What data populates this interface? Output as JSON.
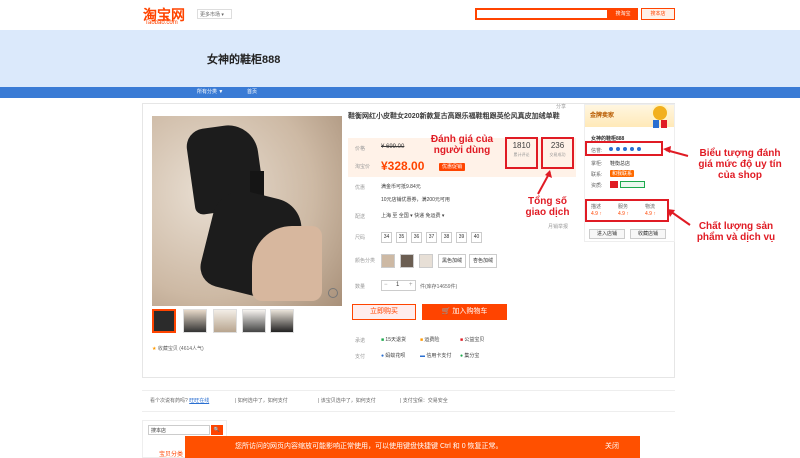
{
  "header": {
    "logo_cn": "淘宝网",
    "logo_en": "Taobao.com",
    "region_select": "更多市场 ▾",
    "search_button": "搜淘宝",
    "search_shop_button": "搜本店"
  },
  "shop": {
    "name": "女神的鞋柜888"
  },
  "nav": {
    "all_categories": "所有分类 ▼",
    "home": "首页"
  },
  "product": {
    "title": "鞋衡网红小皮鞋女2020新款复古高跟乐福鞋粗跟英伦风真皮加绒单鞋",
    "price_label": "价格",
    "old_price": "¥ 699.00",
    "promo_label": "淘宝价",
    "new_price": "¥328.00",
    "promo_badge": "优惠促销",
    "reviews_count": "1810",
    "reviews_label": "累计评论",
    "sales_count": "236",
    "sales_label": "交易成功",
    "share_label": "分享",
    "coupon_label": "优惠",
    "coupon_text": "满金币可抵9.84元",
    "coupon_text2": "10元店铺优惠券，满200元可用",
    "delivery_label": "配送",
    "delivery_text": "上海 至 全国 ▾  快递 免运费 ▾",
    "report": "月销举报",
    "size_label": "尺码",
    "sizes": [
      "34",
      "35",
      "36",
      "37",
      "38",
      "39",
      "40"
    ],
    "color_label": "颜色分类",
    "colors": [
      "黑色加绒",
      "杏色加绒"
    ],
    "qty_label": "数量",
    "qty_value": "1",
    "stock": "件(库存14659件)",
    "buy_now": "立即购买",
    "add_cart": "加入购物车",
    "service_label": "承诺",
    "service1": "15天退货",
    "service2": "运费险",
    "service3": "公益宝贝",
    "pay_label": "支付",
    "pay1": "蚂蚁花呗",
    "pay2": "信用卡支付",
    "pay3": "集分宝",
    "favorite": "收藏宝贝 (4614人气)"
  },
  "sidebar": {
    "gold_seller": "金牌卖家",
    "shop_link": "女神的鞋柜888",
    "credit_label": "信誉:",
    "seller_label": "掌柜:",
    "seller_value": "鞋衡总店",
    "contact_label": "联系:",
    "contact_value": "和我联系",
    "qualify_label": "资质:",
    "desc_label": "描述",
    "desc_value": "4.9 ↑",
    "serv_label": "服务",
    "serv_value": "4.9 ↑",
    "logi_label": "物流",
    "logi_value": "4.9 ↑",
    "enter_shop": "进入店铺",
    "fav_shop": "收藏店铺"
  },
  "annotations": {
    "reviews": "Đánh giá của\nngười dùng",
    "sales": "Tổng số\ngiao dịch",
    "credit": "Biểu tượng đánh\ngiá mức độ uy tín\ncủa shop",
    "quality": "Chất lượng sản\nphẩm và dịch vụ"
  },
  "tips": {
    "t1": "看个次说有药吗?",
    "t1_link": "旺旺在线",
    "t2": "| 如何选中了，如何支付",
    "t3": "| 该宝贝选中了，如何支付",
    "t4": "| 支付宝保：交易安全"
  },
  "shop_search": {
    "placeholder": "搜本店",
    "button": "🔍",
    "link": "宝贝分类"
  },
  "notice_bar": {
    "text": "您所访问的网页内容缩放可能影响正常使用，可以使用键盘快捷键 Ctrl 和 0 恢复正常。",
    "close": "关闭"
  }
}
